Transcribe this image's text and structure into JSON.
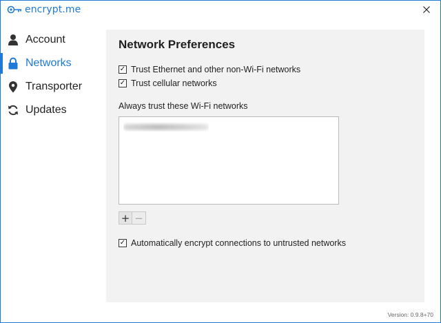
{
  "app": {
    "logo_text": "encrypt.me",
    "accent_color": "#1e7ad6"
  },
  "titlebar": {
    "close_icon": "close-icon"
  },
  "sidebar": {
    "items": [
      {
        "label": "Account",
        "icon": "person-icon",
        "active": false
      },
      {
        "label": "Networks",
        "icon": "lock-icon",
        "active": true
      },
      {
        "label": "Transporter",
        "icon": "map-pin-icon",
        "active": false
      },
      {
        "label": "Updates",
        "icon": "refresh-icon",
        "active": false
      }
    ]
  },
  "main": {
    "title": "Network Preferences",
    "options": {
      "trust_ethernet": {
        "label": "Trust Ethernet and other non-Wi-Fi networks",
        "checked": true
      },
      "trust_cellular": {
        "label": "Trust cellular networks",
        "checked": true
      }
    },
    "wifi": {
      "label": "Always trust these Wi-Fi networks",
      "networks": [
        ""
      ]
    },
    "add_label": "+",
    "remove_label": "−",
    "auto_encrypt": {
      "label": "Automatically encrypt connections to untrusted networks",
      "checked": true
    }
  },
  "footer": {
    "version": "Version: 0.9.8+70"
  }
}
